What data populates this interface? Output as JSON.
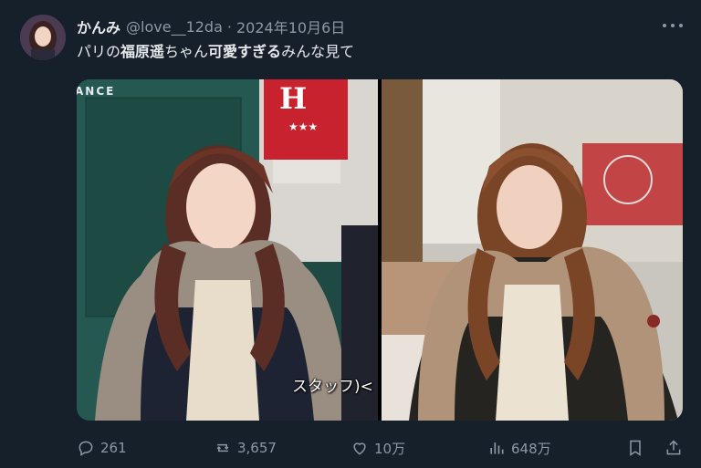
{
  "user": {
    "display_name": "かんみ",
    "handle": "@love__12da",
    "separator": "·",
    "date": "2024年10月6日"
  },
  "tweet": {
    "text_part1": "パリの",
    "text_bold1": "福原遥",
    "text_part2": "ちゃん",
    "text_bold2": "可愛すぎる",
    "text_part3": "みんな見て"
  },
  "media": {
    "left_photo": {
      "sign_letter": "H",
      "corner_text": "ANCE",
      "subtitle": "スタッフ)<"
    }
  },
  "actions": {
    "replies": "261",
    "retweets": "3,657",
    "likes": "10万",
    "views": "648万"
  },
  "icons": [
    "more-icon",
    "reply-icon",
    "retweet-icon",
    "like-icon",
    "views-icon",
    "bookmark-icon",
    "share-icon"
  ],
  "colors": {
    "background": "#15202b",
    "text": "#e7e9ea",
    "muted": "#8b98a5"
  }
}
